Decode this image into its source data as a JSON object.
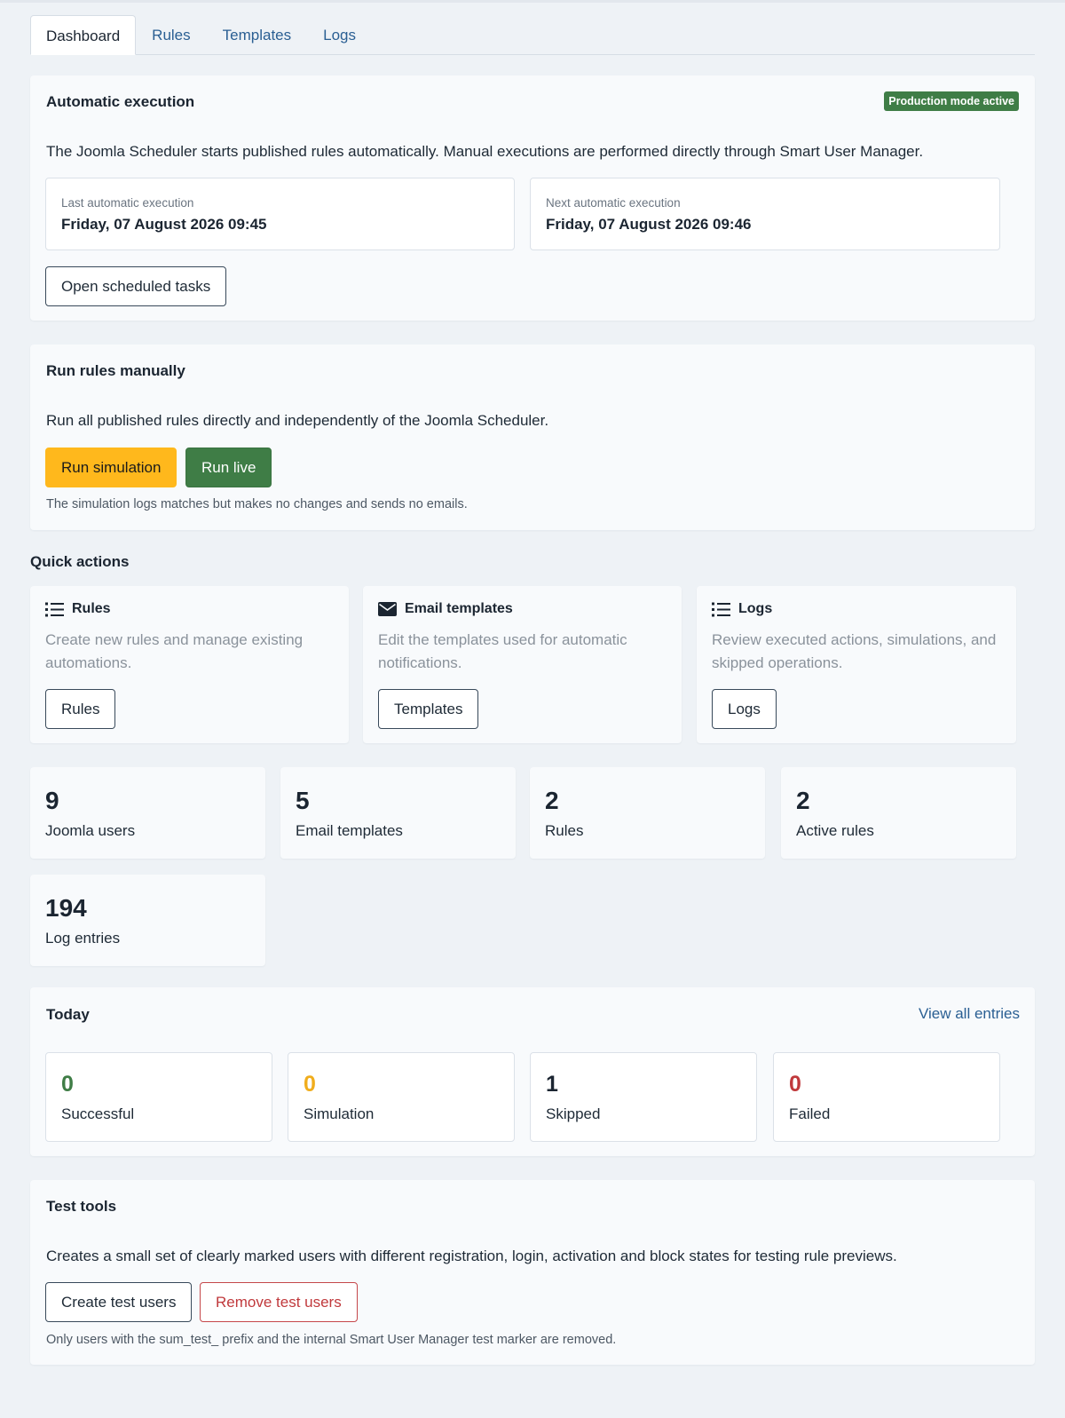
{
  "tabs": [
    {
      "label": "Dashboard",
      "active": true
    },
    {
      "label": "Rules",
      "active": false
    },
    {
      "label": "Templates",
      "active": false
    },
    {
      "label": "Logs",
      "active": false
    }
  ],
  "automatic": {
    "title": "Automatic execution",
    "badge": "Production mode active",
    "description": "The Joomla Scheduler starts published rules automatically. Manual executions are performed directly through Smart User Manager.",
    "last_label": "Last automatic execution",
    "last_value": "Friday, 07 August 2026 09:45",
    "next_label": "Next automatic execution",
    "next_value": "Friday, 07 August 2026 09:46",
    "open_tasks_button": "Open scheduled tasks"
  },
  "manual": {
    "title": "Run rules manually",
    "description": "Run all published rules directly and independently of the Joomla Scheduler.",
    "simulation_button": "Run simulation",
    "live_button": "Run live",
    "hint": "The simulation logs matches but makes no changes and sends no emails."
  },
  "quick_actions": {
    "heading": "Quick actions",
    "items": [
      {
        "icon": "list-icon",
        "title": "Rules",
        "description": "Create new rules and manage existing automations.",
        "button": "Rules"
      },
      {
        "icon": "envelope-icon",
        "title": "Email templates",
        "description": "Edit the templates used for automatic notifications.",
        "button": "Templates"
      },
      {
        "icon": "list-icon",
        "title": "Logs",
        "description": "Review executed actions, simulations, and skipped operations.",
        "button": "Logs"
      }
    ]
  },
  "stats": [
    {
      "value": "9",
      "label": "Joomla users"
    },
    {
      "value": "5",
      "label": "Email templates"
    },
    {
      "value": "2",
      "label": "Rules"
    },
    {
      "value": "2",
      "label": "Active rules"
    },
    {
      "value": "194",
      "label": "Log entries"
    }
  ],
  "today": {
    "title": "Today",
    "view_all": "View all entries",
    "items": [
      {
        "value": "0",
        "label": "Successful",
        "color": "#3f7d46"
      },
      {
        "value": "0",
        "label": "Simulation",
        "color": "#f0ad1c"
      },
      {
        "value": "1",
        "label": "Skipped",
        "color": "#1b2531"
      },
      {
        "value": "0",
        "label": "Failed",
        "color": "#c0393c"
      }
    ]
  },
  "test_tools": {
    "title": "Test tools",
    "description": "Creates a small set of clearly marked users with different registration, login, activation and block states for testing rule previews.",
    "create_button": "Create test users",
    "remove_button": "Remove test users",
    "hint": "Only users with the sum_test_ prefix and the internal Smart User Manager test marker are removed."
  },
  "colors": {
    "accent_link": "#2a5f93",
    "success": "#3f7d46",
    "warning": "#ffb81c",
    "danger": "#c0393c"
  }
}
